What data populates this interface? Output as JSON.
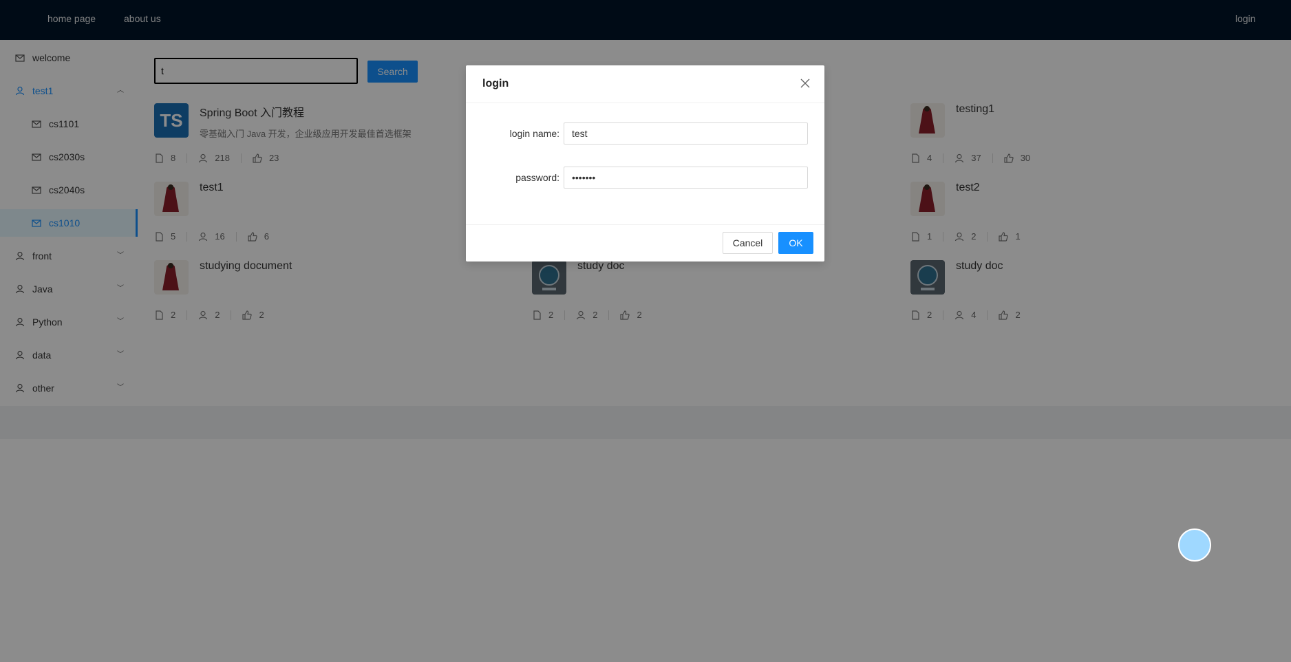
{
  "header": {
    "nav": [
      "home page",
      "about us"
    ],
    "login_label": "login"
  },
  "sidebar": {
    "items": [
      {
        "label": "welcome",
        "icon": "mail-icon"
      },
      {
        "label": "test1",
        "icon": "user-icon",
        "expanded": true
      },
      {
        "label": "cs1101",
        "icon": "mail-icon"
      },
      {
        "label": "cs2030s",
        "icon": "mail-icon"
      },
      {
        "label": "cs2040s",
        "icon": "mail-icon"
      },
      {
        "label": "cs1010",
        "icon": "mail-icon",
        "selected": true
      },
      {
        "label": "front",
        "icon": "user-icon"
      },
      {
        "label": "Java",
        "icon": "user-icon"
      },
      {
        "label": "Python",
        "icon": "user-icon"
      },
      {
        "label": "data",
        "icon": "user-icon"
      },
      {
        "label": "other",
        "icon": "user-icon"
      }
    ]
  },
  "search": {
    "value": "t",
    "button_label": "Search"
  },
  "ebooks": [
    {
      "title": "Spring Boot 入门教程",
      "description": "零基础入门 Java 开发，企业级应用开发最佳首选框架",
      "avatar": "TS",
      "docs": "8",
      "views": "218",
      "votes": "23"
    },
    {
      "title": "testing1",
      "description": "",
      "avatar": "image",
      "docs": "4",
      "views": "37",
      "votes": "30"
    },
    {
      "title": "test1",
      "description": "",
      "avatar": "image",
      "docs": "5",
      "views": "16",
      "votes": "6"
    },
    {
      "title": "test2",
      "description": "",
      "avatar": "image",
      "docs": "1",
      "views": "2",
      "votes": "1"
    },
    {
      "title": "studying document",
      "description": "",
      "avatar": "image",
      "docs": "2",
      "views": "2",
      "votes": "2"
    },
    {
      "title": "study doc",
      "description": "",
      "avatar": "typescript-image",
      "docs": "2",
      "views": "2",
      "votes": "2"
    },
    {
      "title": "study doc",
      "description": "",
      "avatar": "typescript-image",
      "docs": "2",
      "views": "4",
      "votes": "2"
    }
  ],
  "modal": {
    "title": "login",
    "login_name_label": "login name:",
    "login_name_value": "test",
    "password_label": "password:",
    "password_value": "•••••••",
    "cancel_label": "Cancel",
    "ok_label": "OK"
  },
  "colors": {
    "header_bg": "#001529",
    "accent": "#1890ff",
    "mask": "rgba(0,0,0,0.45)"
  }
}
